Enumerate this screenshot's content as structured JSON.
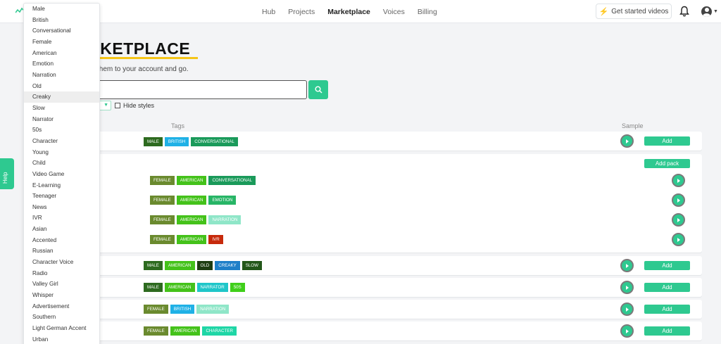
{
  "nav": {
    "links": [
      {
        "label": "Hub",
        "active": false
      },
      {
        "label": "Projects",
        "active": false
      },
      {
        "label": "Marketplace",
        "active": true
      },
      {
        "label": "Voices",
        "active": false
      },
      {
        "label": "Billing",
        "active": false
      }
    ],
    "cta_label": "Get started videos",
    "bell_icon": "bell-icon",
    "avatar_icon": "user-avatar-icon"
  },
  "page": {
    "title": "ARKETPLACE",
    "subtitle": "st add them to your account and go.",
    "search_value": "",
    "hide_styles_label": "Hide styles",
    "col_tags": "Tags",
    "col_sample": "Sample"
  },
  "help": {
    "label": "Help"
  },
  "colors": {
    "accent": "#2ec990",
    "underline": "#f5c518"
  },
  "dropdown": {
    "highlighted_index": 8,
    "options": [
      "Male",
      "British",
      "Conversational",
      "Female",
      "American",
      "Emotion",
      "Narration",
      "Old",
      "Creaky",
      "Slow",
      "Narrator",
      "50s",
      "Character",
      "Young",
      "Child",
      "Video Game",
      "E-Learning",
      "Teenager",
      "News",
      "IVR",
      "Asian",
      "Accented",
      "Russian",
      "Character Voice",
      "Radio",
      "Valley Girl",
      "Whisper",
      "Advertisement",
      "Southern",
      "Light German Accent",
      "Urban"
    ]
  },
  "voices": [
    {
      "tags": [
        {
          "t": "MALE",
          "c": "#2d6a1f"
        },
        {
          "t": "BRITISH",
          "c": "#1fb1e6"
        },
        {
          "t": "CONVERSATIONAL",
          "c": "#1a9a5a"
        }
      ],
      "add_label": "Add"
    },
    {
      "pack": true,
      "add_label": "Add pack",
      "items": [
        {
          "tags": [
            {
              "t": "FEMALE",
              "c": "#6a8a2e"
            },
            {
              "t": "AMERICAN",
              "c": "#44c21a"
            },
            {
              "t": "CONVERSATIONAL",
              "c": "#1a9a5a"
            }
          ]
        },
        {
          "tags": [
            {
              "t": "FEMALE",
              "c": "#6a8a2e"
            },
            {
              "t": "AMERICAN",
              "c": "#44c21a"
            },
            {
              "t": "EMOTION",
              "c": "#27b566"
            }
          ]
        },
        {
          "tags": [
            {
              "t": "FEMALE",
              "c": "#6a8a2e"
            },
            {
              "t": "AMERICAN",
              "c": "#44c21a"
            },
            {
              "t": "NARRATION",
              "c": "#8fe6c8"
            }
          ]
        },
        {
          "tags": [
            {
              "t": "FEMALE",
              "c": "#6a8a2e"
            },
            {
              "t": "AMERICAN",
              "c": "#44c21a"
            },
            {
              "t": "IVR",
              "c": "#c72a0c"
            }
          ]
        }
      ]
    },
    {
      "tags": [
        {
          "t": "MALE",
          "c": "#2d6a1f"
        },
        {
          "t": "AMERICAN",
          "c": "#44c21a"
        },
        {
          "t": "OLD",
          "c": "#1e3d12"
        },
        {
          "t": "CREAKY",
          "c": "#1e7fc8"
        },
        {
          "t": "SLOW",
          "c": "#23571a"
        }
      ],
      "add_label": "Add"
    },
    {
      "tags": [
        {
          "t": "MALE",
          "c": "#2d6a1f"
        },
        {
          "t": "AMERICAN",
          "c": "#44c21a"
        },
        {
          "t": "NARRATOR",
          "c": "#1fc6c9"
        },
        {
          "t": "50S",
          "c": "#3fcf1a"
        }
      ],
      "add_label": "Add"
    },
    {
      "tags": [
        {
          "t": "FEMALE",
          "c": "#6a8a2e"
        },
        {
          "t": "BRITISH",
          "c": "#1fb1e6"
        },
        {
          "t": "NARRATION",
          "c": "#8fe6c8"
        }
      ],
      "add_label": "Add"
    },
    {
      "tags": [
        {
          "t": "FEMALE",
          "c": "#6a8a2e"
        },
        {
          "t": "AMERICAN",
          "c": "#44c21a"
        },
        {
          "t": "CHARACTER",
          "c": "#1fd6a6"
        }
      ],
      "add_label": "Add"
    }
  ]
}
